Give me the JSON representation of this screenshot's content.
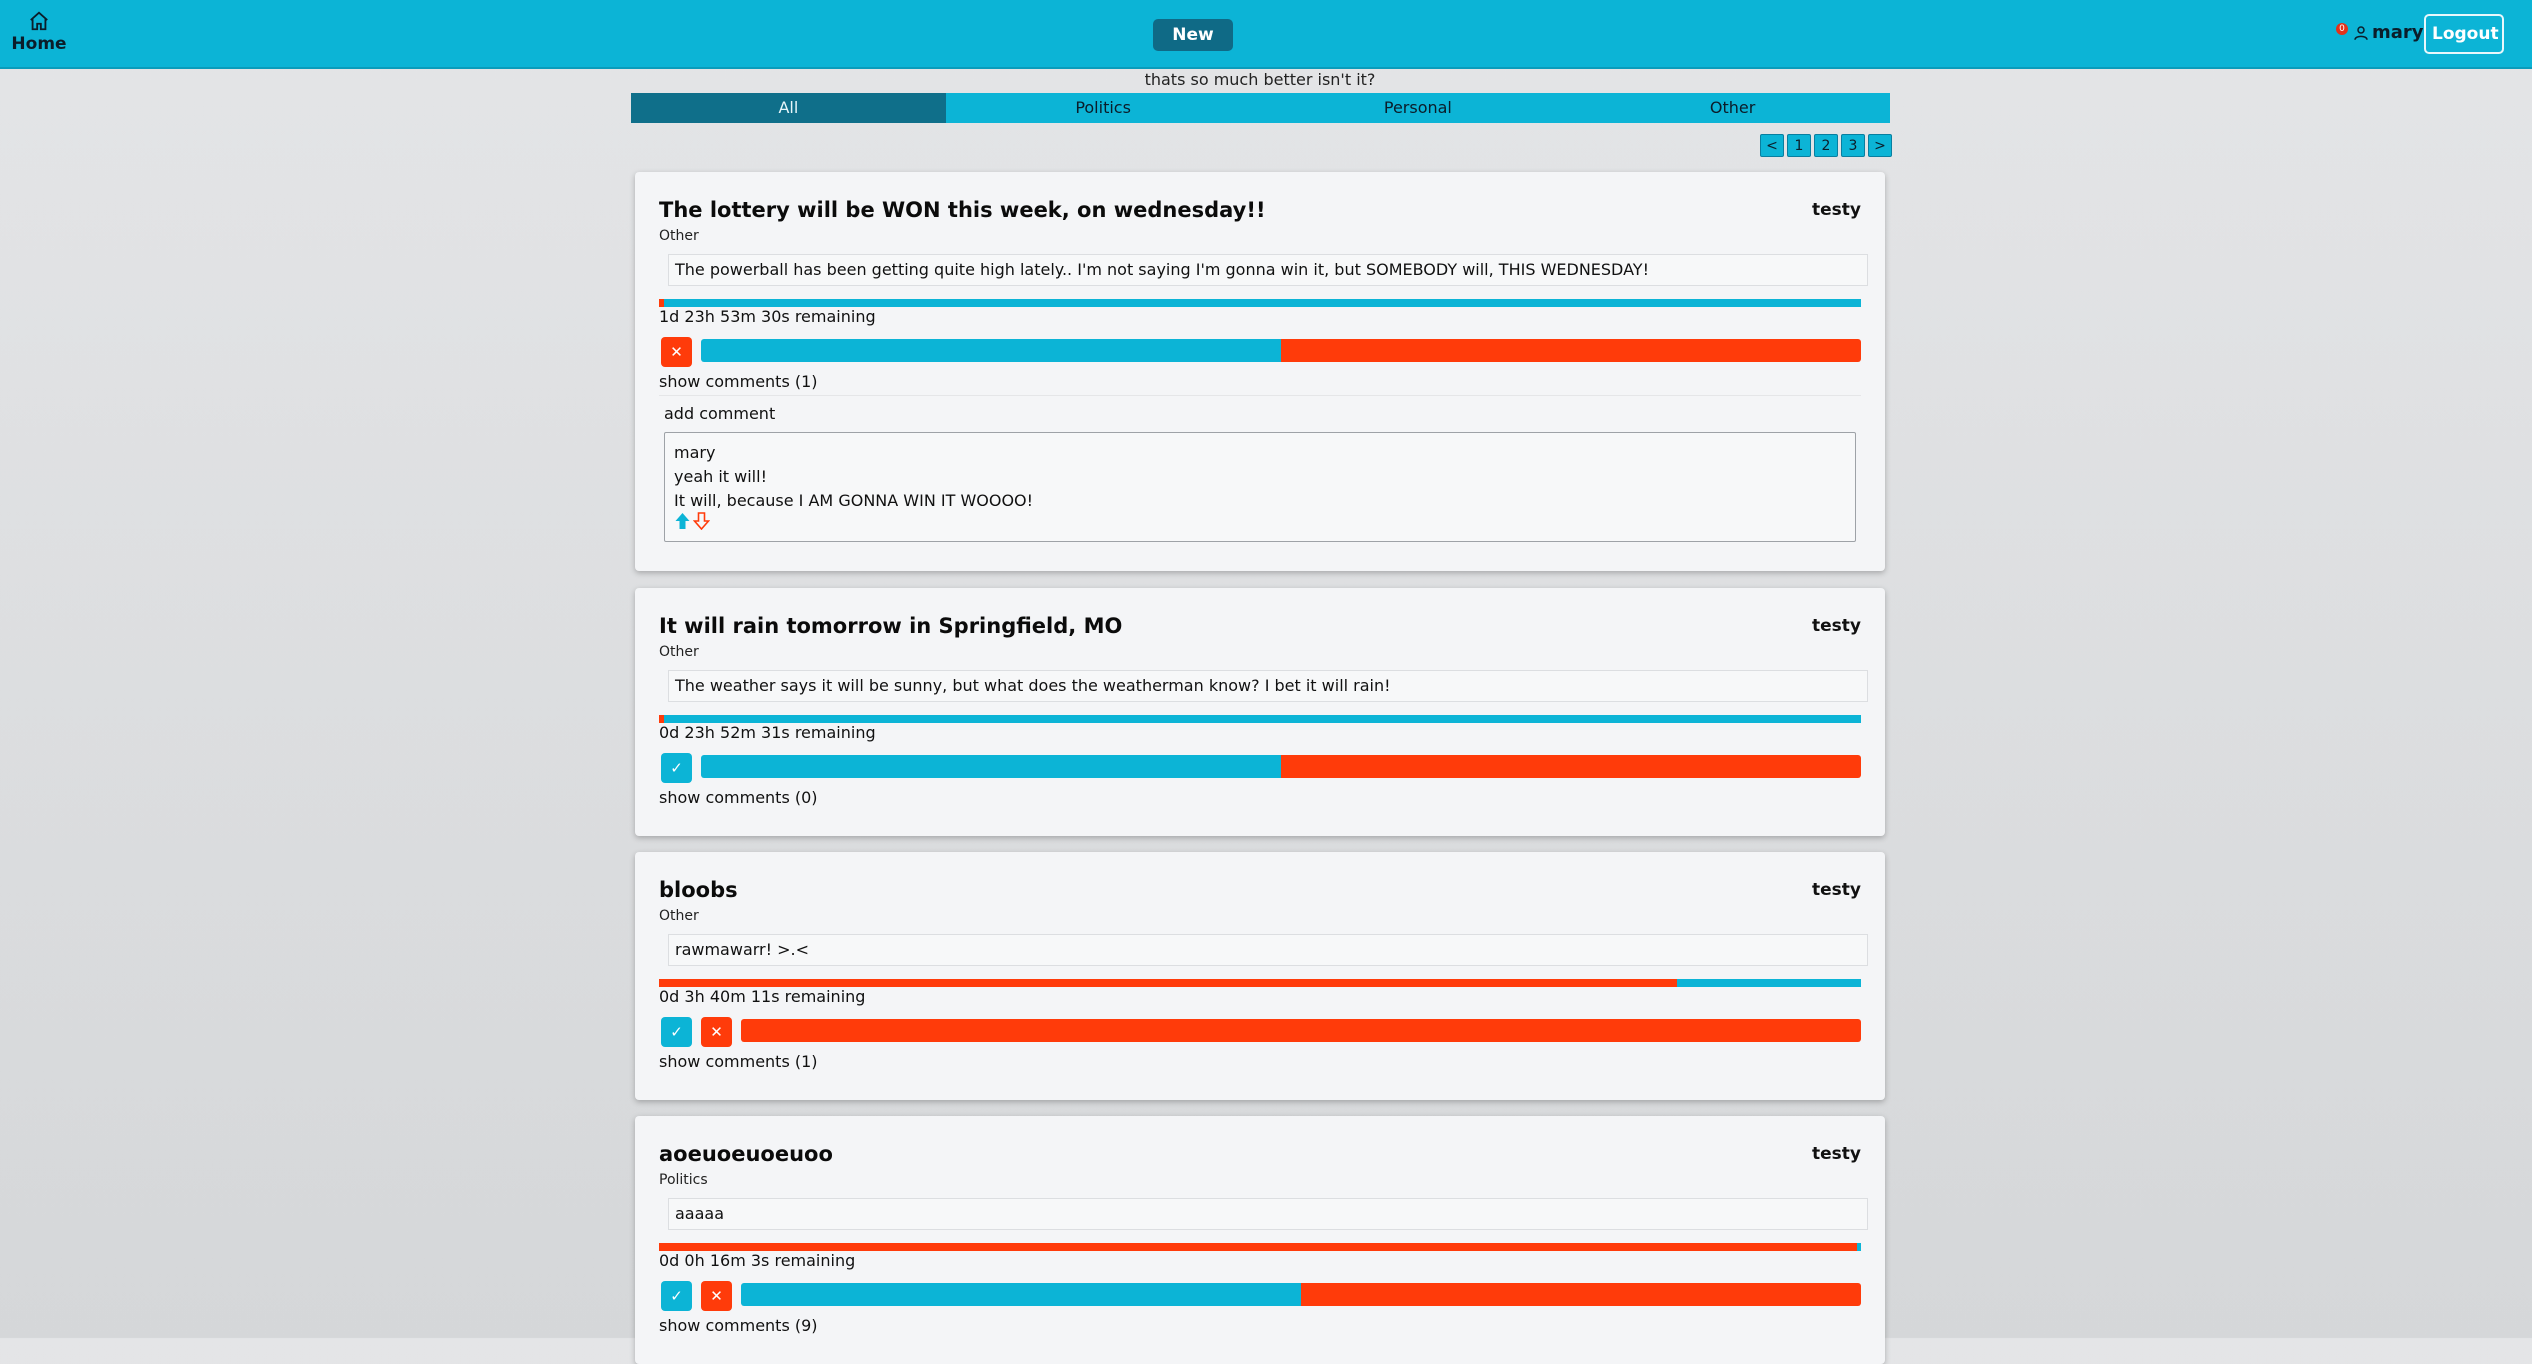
{
  "header": {
    "home_label": "Home",
    "new_label": "New",
    "notif_count": "0",
    "username": "mary",
    "logout_label": "Logout"
  },
  "tagline": "thats so much better isn't it?",
  "tabs": [
    {
      "label": "All",
      "active": true
    },
    {
      "label": "Politics"
    },
    {
      "label": "Personal"
    },
    {
      "label": "Other"
    }
  ],
  "pager": [
    "<",
    "1",
    "2",
    "3",
    ">"
  ],
  "colors": {
    "accent": "#0cb4d6",
    "dark_accent": "#0f6f8a",
    "red": "#ff3b0a"
  },
  "posts": [
    {
      "title": "The lottery will be WON this week, on wednesday!!",
      "author": "testy",
      "category": "Other",
      "body": "The powerball has been getting quite high lately.. I'm not saying I'm gonna win it, but SOMEBODY will, THIS WEDNESDAY!",
      "time_fraction_red": 0.004,
      "remaining": "1d 23h 53m 30s remaining",
      "vote_buttons": [
        "down"
      ],
      "vote_yes_fraction": 0.5,
      "show_comments": "show comments (1)",
      "add_comment": "add comment",
      "comment": {
        "author": "mary",
        "title": "yeah it will!",
        "text": "It will, because I AM GONNA WIN IT WOOOO!"
      }
    },
    {
      "title": "It will rain tomorrow in Springfield, MO",
      "author": "testy",
      "category": "Other",
      "body": "The weather says it will be sunny, but what does the weatherman know? I bet it will rain!",
      "time_fraction_red": 0.004,
      "remaining": "0d 23h 52m 31s remaining",
      "vote_buttons": [
        "up"
      ],
      "vote_yes_fraction": 0.5,
      "show_comments": "show comments (0)"
    },
    {
      "title": "bloobs",
      "author": "testy",
      "category": "Other",
      "body": "rawmawarr! >.<",
      "time_fraction_red": 0.847,
      "remaining": "0d 3h 40m 11s remaining",
      "vote_buttons": [
        "up",
        "down"
      ],
      "vote_yes_fraction": 0.0,
      "show_comments": "show comments (1)"
    },
    {
      "title": "aoeuoeuoeuoo",
      "author": "testy",
      "category": "Politics",
      "body": "aaaaa",
      "time_fraction_red": 0.997,
      "remaining": "0d 0h 16m 3s remaining",
      "vote_buttons": [
        "up",
        "down"
      ],
      "vote_yes_fraction": 0.5,
      "show_comments": "show comments (9)"
    }
  ]
}
